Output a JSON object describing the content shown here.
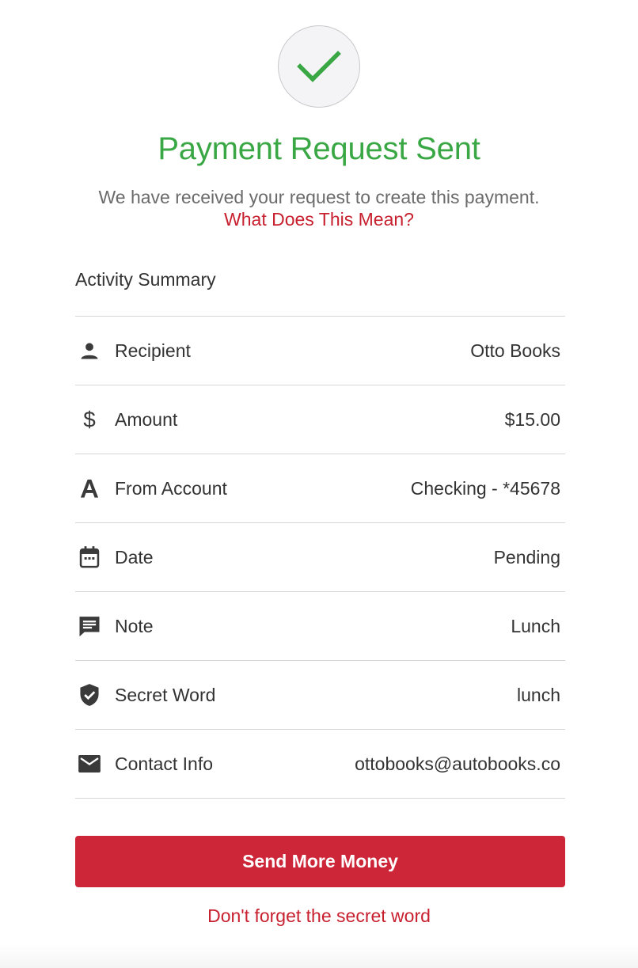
{
  "header": {
    "title": "Payment Request Sent",
    "subtitle": "We have received your request to create this payment.",
    "info_link": "What Does This Mean?"
  },
  "summary": {
    "heading": "Activity Summary",
    "rows": [
      {
        "icon": "person-icon",
        "label": "Recipient",
        "value": "Otto Books"
      },
      {
        "icon": "dollar-icon",
        "label": "Amount",
        "value": "$15.00"
      },
      {
        "icon": "account-letter-icon",
        "label": "From Account",
        "value": "Checking - *45678"
      },
      {
        "icon": "calendar-icon",
        "label": "Date",
        "value": "Pending"
      },
      {
        "icon": "note-icon",
        "label": "Note",
        "value": "Lunch"
      },
      {
        "icon": "shield-check-icon",
        "label": "Secret Word",
        "value": "lunch"
      },
      {
        "icon": "mail-icon",
        "label": "Contact Info",
        "value": "ottobooks@autobooks.co"
      }
    ]
  },
  "actions": {
    "primary_label": "Send More Money",
    "secondary_link": "Don't forget the secret word"
  },
  "colors": {
    "success": "#3aa745",
    "brand_red": "#cd2638",
    "link_red": "#c8202f"
  }
}
